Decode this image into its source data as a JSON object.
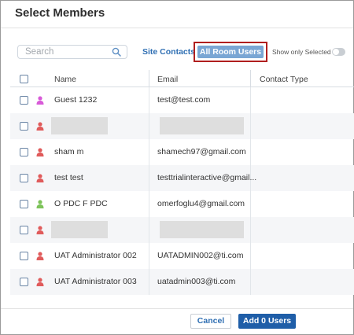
{
  "dialog": {
    "title": "Select Members"
  },
  "search": {
    "placeholder": "Search"
  },
  "tabs": {
    "site_contacts": "Site Contacts",
    "all_room_users": "All Room Users"
  },
  "filter": {
    "show_only_selected": "Show only Selected",
    "show_only_selected_on": false
  },
  "table": {
    "headers": {
      "name": "Name",
      "email": "Email",
      "contact_type": "Contact Type"
    },
    "rows": [
      {
        "name": "Guest 1232",
        "email": "test@test.com",
        "contact_type": "",
        "icon_color": "#d85ad8",
        "redacted": false
      },
      {
        "name": "",
        "email": "",
        "contact_type": "",
        "icon_color": "#e05b5b",
        "redacted": true
      },
      {
        "name": "sham m",
        "email": "shamech97@gmail.com",
        "contact_type": "",
        "icon_color": "#e05b5b",
        "redacted": false
      },
      {
        "name": "test test",
        "email": "testtrialinteractive@gmail...",
        "contact_type": "",
        "icon_color": "#e05b5b",
        "redacted": false
      },
      {
        "name": "O PDC F PDC",
        "email": "omerfoglu4@gmail.com",
        "contact_type": "",
        "icon_color": "#7dc35a",
        "redacted": false
      },
      {
        "name": "",
        "email": "",
        "contact_type": "",
        "icon_color": "#e05b5b",
        "redacted": true
      },
      {
        "name": "UAT Administrator 002",
        "email": "UATADMIN002@ti.com",
        "contact_type": "",
        "icon_color": "#e05b5b",
        "redacted": false
      },
      {
        "name": "UAT Administrator 003",
        "email": "uatadmin003@ti.com",
        "contact_type": "",
        "icon_color": "#e05b5b",
        "redacted": false
      }
    ]
  },
  "footer": {
    "cancel": "Cancel",
    "add": "Add 0 Users"
  },
  "colors": {
    "accent": "#1f5ea8",
    "active_tab": "#7aa6d4",
    "highlight_border": "#b01e1e"
  }
}
